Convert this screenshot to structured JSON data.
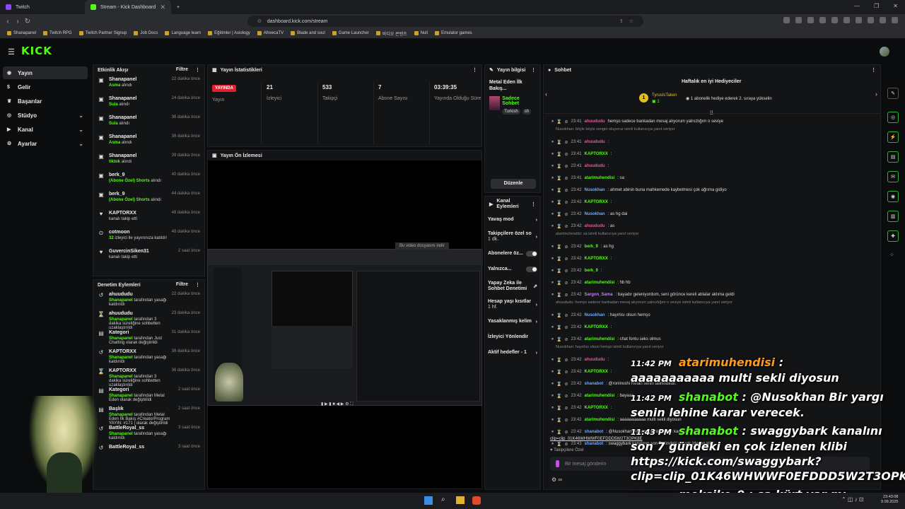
{
  "browser": {
    "tabs": [
      {
        "label": "Twitch",
        "color": "#9146ff"
      },
      {
        "label": "Stream - Kick Dashboard",
        "color": "#53fc18"
      }
    ],
    "url": "dashboard.kick.com/stream",
    "bookmarks": [
      "Shanapanel",
      "Twitch RPG",
      "Twitch Partner Signup",
      "Job Docs",
      "Language learn",
      "Eğitimler | Asiology",
      "AfreecaTV",
      "Blade and soul",
      "Game Launcher",
      "바디오 콘텐츠",
      "Null",
      "Emulator games"
    ]
  },
  "brand": {
    "logo": "KICK",
    "accent": "#53fc18"
  },
  "sidebar": [
    {
      "label": "Yayın",
      "icon": "broadcast-icon",
      "active": true
    },
    {
      "label": "Gelir",
      "icon": "money-icon"
    },
    {
      "label": "Başarılar",
      "icon": "trophy-icon"
    },
    {
      "label": "Stüdyo",
      "icon": "studio-icon",
      "chev": true
    },
    {
      "label": "Kanal",
      "icon": "channel-icon",
      "chev": true
    },
    {
      "label": "Ayarlar",
      "icon": "gear-icon",
      "chev": true
    }
  ],
  "activity": {
    "title": "Etkinlik Akışı",
    "filter": "Filtre",
    "items": [
      {
        "name": "Shanapanel",
        "hl": "Asma",
        "text": "alındı",
        "time": "22 dakika önce"
      },
      {
        "name": "Shanapanel",
        "hl": "Sula",
        "text": "alındı",
        "time": "24 dakika önce"
      },
      {
        "name": "Shanapanel",
        "hl": "Sula",
        "text": "alındı",
        "time": "36 dakika önce"
      },
      {
        "name": "Shanapanel",
        "hl": "Asma",
        "text": "alındı",
        "time": "36 dakika önce"
      },
      {
        "name": "Shanapanel",
        "hl": "tiktok",
        "text": "alındı",
        "time": "39 dakika önce"
      },
      {
        "name": "berk_9",
        "hl": "(Abone Özel) Shorts",
        "text": "alındı",
        "time": "40 dakika önce"
      },
      {
        "name": "berk_9",
        "hl": "(Abone Özel) Shorts",
        "text": "alındı",
        "time": "44 dakika önce"
      },
      {
        "name": "KAPTORXX",
        "hl": "",
        "text": "kanalı takip etti",
        "time": "48 dakika önce"
      },
      {
        "name": "cotmoon",
        "hl": "32",
        "text": "izleyici ile yayınınıza katıldı!",
        "time": "48 dakika önce"
      },
      {
        "name": "GuvercinSiken31",
        "hl": "",
        "text": "kanalı takip etti",
        "time": "2 saat önce"
      }
    ]
  },
  "moderation": {
    "title": "Denetim Eylemleri",
    "filter": "Filtre",
    "items": [
      {
        "name": "ahuududu",
        "hl": "Shanapanel",
        "text": "tarafından yasağı kaldırıldı",
        "time": "22 dakika önce"
      },
      {
        "name": "ahuududu",
        "hl": "Shanapanel",
        "text": "tarafından 3 dakika süreliğine sohbetten uzaklaştırıldı",
        "time": "23 dakika önce"
      },
      {
        "name": "Kategori",
        "hl": "Shanapanel",
        "text": "tarafından Just Chatting olarak değiştirildi",
        "time": "31 dakika önce"
      },
      {
        "name": "KAPTORXX",
        "hl": "Shanapanel",
        "text": "tarafından yasağı kaldırıldı",
        "time": "36 dakika önce"
      },
      {
        "name": "KAPTORXX",
        "hl": "Shanapanel",
        "text": "tarafından 3 dakika süreliğine sohbetten uzaklaştırıldı",
        "time": "36 dakika önce"
      },
      {
        "name": "Kategori",
        "hl": "Shanapanel",
        "text": "tarafından Metal Eden olarak değiştirildi",
        "time": "2 saat önce"
      },
      {
        "name": "Başlık",
        "hl": "Shanapanel",
        "text": "tarafından Metal Eden İlk Bakış #CreatorProgram YAYIN: #171 | olarak değiştirildi",
        "time": "2 saat önce"
      },
      {
        "name": "BattleRoyal_ss",
        "hl": "Shanapanel",
        "text": "tarafından yasağı kaldırıldı",
        "time": "3 saat önce"
      },
      {
        "name": "BattleRoyal_ss",
        "hl": "",
        "text": "",
        "time": "3 saat önce"
      }
    ]
  },
  "stats": {
    "title": "Yayın İstatistikleri",
    "live": "YAYINDA",
    "live_label": "Yayın",
    "items": [
      {
        "value": "21",
        "label": "İzleyici"
      },
      {
        "value": "533",
        "label": "Takipçi"
      },
      {
        "value": "7",
        "label": "Abone Sayısı"
      },
      {
        "value": "03:39:35",
        "label": "Yayında Olduğu Süre"
      }
    ]
  },
  "preview": {
    "title": "Yayın Ön İzlemesi",
    "notice": "Bu video dosyasını indir"
  },
  "info": {
    "title": "Yayın bilgisi",
    "stream_title": "Metal Eden İlk Bakış...",
    "category": "Sadece Sohbet",
    "tags": [
      "Turkish",
      "sh"
    ],
    "edit": "Düzenle"
  },
  "channel_actions": {
    "title": "Kanal Eylemleri",
    "items": [
      {
        "label": "Yavaş mod",
        "type": "arrow"
      },
      {
        "label": "Takipçilere özel so",
        "sub": "1 dk.",
        "type": "arrow"
      },
      {
        "label": "Abonelere öz...",
        "type": "toggle"
      },
      {
        "label": "Yalnızca...",
        "type": "toggle"
      },
      {
        "label": "Yapay Zeka ile Sohbet Denetimi",
        "type": "ext"
      },
      {
        "label": "Hesap yaşı kısıtlar",
        "sub": "1 hf.",
        "type": "arrow"
      },
      {
        "label": "Yasaklanmış kelim",
        "type": "arrow"
      },
      {
        "label": "İzleyici Yönlendir",
        "type": "none"
      },
      {
        "label": "Aktif hedefler - 1",
        "type": "arrow"
      }
    ]
  },
  "chat": {
    "title": "Sohbet",
    "top_title": "Haftalık en iyi Hediyeciler",
    "top_gifter": "TyrusIsTaken",
    "top_count": "1",
    "top_msg": "1 abonelik hediye ederek 2. sıraya yükselin",
    "rows": [
      {
        "time": "23:41",
        "user": "ahuududu",
        "color": "#e05a9a",
        "msg": "hemşo sadece bankadan mesaj alıyorum yalnızlığım o seviye"
      },
      {
        "reply": "Nusokhan: böyle böyle zengin oluyoruz isimli kullanıcıya yanıt veriyor"
      },
      {
        "time": "23:41",
        "user": "ahuududu",
        "color": "#e05a9a",
        "msg": ":"
      },
      {
        "time": "23:41",
        "user": "KAPTORXX",
        "color": "#53fc18",
        "msg": ":"
      },
      {
        "time": "23:41",
        "user": "ahuududu",
        "color": "#e05a9a",
        "msg": ":"
      },
      {
        "time": "23:41",
        "user": "atarimuhendisi",
        "color": "#53fc18",
        "msg": ": sa"
      },
      {
        "time": "23:42",
        "user": "Nusokhan",
        "color": "#6fa8ff",
        "msg": ": ahmet abinin buna mahkemede kaybetmesi çok ağrıma gidiyo"
      },
      {
        "time": "23:42",
        "user": "KAPTORXX",
        "color": "#53fc18",
        "msg": ":"
      },
      {
        "time": "23:42",
        "user": "Nusokhan",
        "color": "#6fa8ff",
        "msg": ": as hg dai"
      },
      {
        "time": "23:42",
        "user": "ahuududu",
        "color": "#e05a9a",
        "msg": ": as"
      },
      {
        "reply": "atarimuhendisi: sa isimli kullanıcıya yanıt veriyor"
      },
      {
        "time": "23:42",
        "user": "berk_9",
        "color": "#53fc18",
        "msg": ": as hg"
      },
      {
        "time": "23:42",
        "user": "KAPTORXX",
        "color": "#53fc18",
        "msg": ":"
      },
      {
        "time": "23:42",
        "user": "berk_9",
        "color": "#53fc18",
        "msg": ":"
      },
      {
        "time": "23:42",
        "user": "atarimuhendisi",
        "color": "#53fc18",
        "msg": ": hb hb"
      },
      {
        "time": "23:42",
        "user": "Sargon_Sama",
        "color": "#c77dff",
        "msg": ": bayadır geleniyordum, seni görünce kereli ablalar aklıma geldi"
      },
      {
        "reply": "ahuududu: hemşo sadece bankadan mesaj alıyorum yalnızlığım o seviye isimli kullanıcıya yanıt veriyor"
      },
      {
        "time": "23:42",
        "user": "Nusokhan",
        "color": "#6fa8ff",
        "msg": ": hayırlısı olsun hemşo"
      },
      {
        "time": "23:42",
        "user": "KAPTORXX",
        "color": "#53fc18",
        "msg": ":"
      },
      {
        "time": "23:42",
        "user": "atarimuhendisi",
        "color": "#53fc18",
        "msg": ": chat fontu seks olmus"
      },
      {
        "reply": "Nusokhan: hayırlısı olsun hemşo isimli kullanıcıya yanıt veriyor"
      },
      {
        "time": "23:42",
        "user": "ahuududu",
        "color": "#e05a9a",
        "msg": ":"
      },
      {
        "time": "23:42",
        "user": "KAPTORXX",
        "color": "#53fc18",
        "msg": ":"
      },
      {
        "time": "23:42",
        "user": "shanabot",
        "color": "#6fa8ff",
        "msg": ": @roninoshi Refah senin talihindedir."
      },
      {
        "time": "23:42",
        "user": "atarimuhendisi",
        "color": "#53fc18",
        "msg": ": bayaaa"
      },
      {
        "time": "23:42",
        "user": "KAPTORXX",
        "color": "#53fc18",
        "msg": ":"
      },
      {
        "time": "23:42",
        "user": "atarimuhendisi",
        "color": "#53fc18",
        "msg": ": aaaaaaaaaaa multi sekli diyosun"
      },
      {
        "time": "23:42",
        "user": "shanabot",
        "color": "#6fa8ff",
        "msg": ": @Nusokhan Bir yargı senin lehine karar verecek."
      },
      {
        "time": "23:43",
        "user": "shanabot",
        "color": "#6fa8ff",
        "msg": ": swaggybark kanalının son 7 gündeki en çok izlenen klibi"
      }
    ],
    "clip": "clip=clip_01K46WHWWF0EFDDD5W2T3OPK8E",
    "followers_only": "Takipçilere Özel",
    "input_placeholder": "Bir mesaj gönderin",
    "send": "Sohbet"
  },
  "overlay": [
    {
      "time": "11:42 PM",
      "user": "atarimuhendisi",
      "ucolor": "#ff9a1a",
      "text": "aaaaaaaaaaa multi sekli diyosun"
    },
    {
      "time": "11:42 PM",
      "user": "shanabot",
      "ucolor": "#53fc18",
      "text": "@Nusokhan Bir yargı",
      "text2": "senin lehine karar verecek."
    },
    {
      "time": "11:43 PM",
      "user": "shanabot",
      "ucolor": "#53fc18",
      "text": "swaggybark kanalını",
      "text2": "son 7 gündeki en çok izlenen klibi",
      "text3": "https://kick.com/swaggybark?",
      "text4": "clip=clip_01K46WHWWF0EFDDD5W2T3OPK8"
    },
    {
      "time": "11:43 PM",
      "user": "meksiko_9",
      "ucolor": "#ffffff",
      "text": "sa kürt var mı"
    }
  ],
  "taskbar": {
    "time": "23:43:08",
    "date": "9.09.2025"
  }
}
